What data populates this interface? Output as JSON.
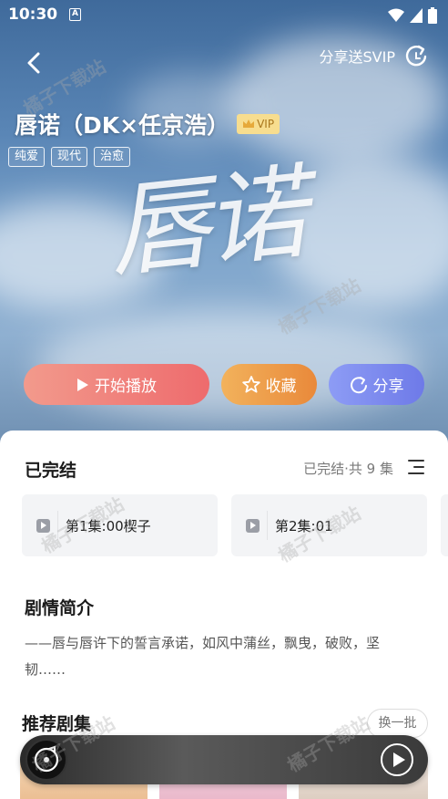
{
  "status_bar": {
    "time": "10:30",
    "sim_label": "A"
  },
  "header": {
    "share_vip_label": "分享送SVIP",
    "title": "唇诺（DK×任京浩）",
    "vip_badge": "VIP",
    "tags": [
      "纯爱",
      "现代",
      "治愈"
    ],
    "cover_text": "唇诺"
  },
  "actions": {
    "play_label": "开始播放",
    "favorite_label": "收藏",
    "share_label": "分享"
  },
  "episodes": {
    "status": "已完结",
    "summary": "已完结·共 9 集",
    "items": [
      "第1集:00楔子",
      "第2集:01"
    ]
  },
  "synopsis": {
    "heading": "剧情简介",
    "text": "——唇与唇许下的誓言承诺，如风中蒲丝，飘曳，破败，坚韧……"
  },
  "recommend": {
    "heading": "推荐剧集",
    "refresh_label": "换一批"
  },
  "watermark": "橘子下载站",
  "colors": {
    "play_gradient": [
      "#f29a8c",
      "#ee6b6d"
    ],
    "favorite_gradient": [
      "#f2b25c",
      "#e9893a"
    ],
    "share_gradient": [
      "#8d9cf5",
      "#6e7ae8"
    ],
    "vip_badge_bg": "#f7dd8f"
  }
}
